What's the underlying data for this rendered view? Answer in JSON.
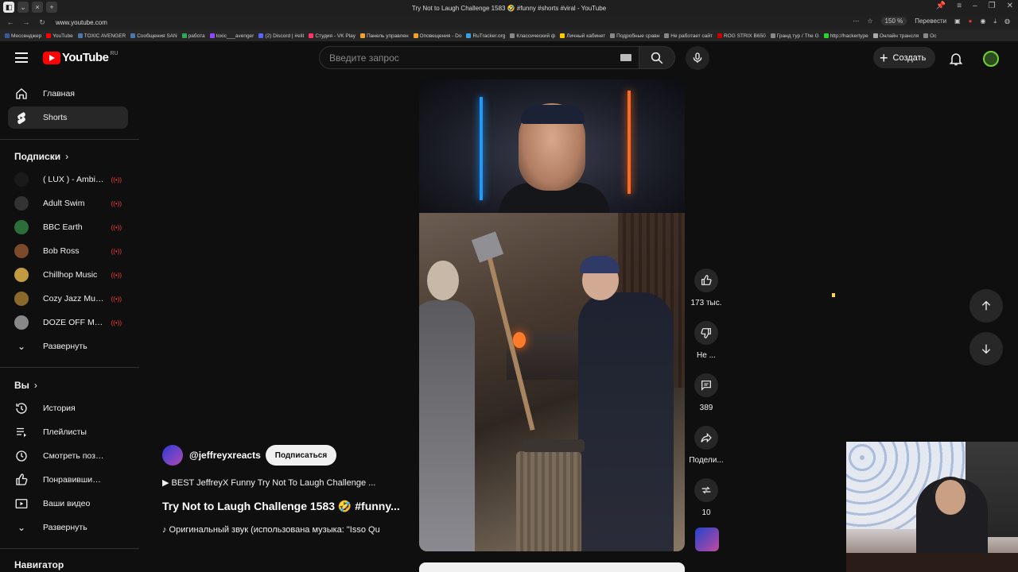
{
  "browser": {
    "url": "www.youtube.com",
    "tab_title": "Try Not to Laugh Challenge 1583 🤣 #funny #shorts #viral - YouTube",
    "zoom": "150 %",
    "translate_label": "Перевести",
    "bookmarks": [
      {
        "label": "Мессенджер",
        "color": "#3b5998"
      },
      {
        "label": "YouTube",
        "color": "#ff0000"
      },
      {
        "label": "TOXIC AVENGER",
        "color": "#4a76a8"
      },
      {
        "label": "Сообщения SAN",
        "color": "#4a76a8"
      },
      {
        "label": "работа",
        "color": "#2fa84f"
      },
      {
        "label": "toxic___avenger",
        "color": "#9146ff"
      },
      {
        "label": "(2) Discord | #elit",
        "color": "#5865f2"
      },
      {
        "label": "Студия - VK Play",
        "color": "#ff3366"
      },
      {
        "label": "Панель управлен",
        "color": "#f0a030"
      },
      {
        "label": "Оповещения - Do",
        "color": "#f0a030"
      },
      {
        "label": "RuTracker.org",
        "color": "#3aa0e0"
      },
      {
        "label": "Классический ф",
        "color": "#888888"
      },
      {
        "label": "Личный кабинет",
        "color": "#ffcc00"
      },
      {
        "label": "Подробные сравн",
        "color": "#888888"
      },
      {
        "label": "Не работает сайт",
        "color": "#888888"
      },
      {
        "label": "ROG STRIX B650",
        "color": "#cc0000"
      },
      {
        "label": "Гранд тур / The G",
        "color": "#888888"
      },
      {
        "label": "http://hackertype",
        "color": "#2bd42b"
      },
      {
        "label": "Онлайн трансля",
        "color": "#aaaaaa"
      },
      {
        "label": "Ос",
        "color": "#888888"
      }
    ]
  },
  "header": {
    "logo_text": "YouTube",
    "logo_region": "RU",
    "search_placeholder": "Введите запрос",
    "create_label": "Создать"
  },
  "sidebar": {
    "main_items": [
      {
        "label": "Главная",
        "icon": "home-icon"
      },
      {
        "label": "Shorts",
        "icon": "shorts-icon",
        "active": true
      }
    ],
    "subscriptions_title": "Подписки",
    "subscriptions": [
      {
        "label": "( LUX ) - Ambient...",
        "color": "#1a1a1a"
      },
      {
        "label": "Adult Swim",
        "color": "#333333"
      },
      {
        "label": "BBC Earth",
        "color": "#2b6e3a"
      },
      {
        "label": "Bob Ross",
        "color": "#7a4a2a"
      },
      {
        "label": "Chillhop Music",
        "color": "#c29b3e"
      },
      {
        "label": "Cozy Jazz Music",
        "color": "#8a6a2a"
      },
      {
        "label": "DOZE OFF MEDU...",
        "color": "#888888"
      }
    ],
    "expand_label_1": "Развернуть",
    "you_title": "Вы",
    "you_items": [
      {
        "label": "История",
        "icon": "history-icon"
      },
      {
        "label": "Плейлисты",
        "icon": "playlists-icon"
      },
      {
        "label": "Смотреть позже",
        "icon": "watch-later-icon"
      },
      {
        "label": "Понравившиеся",
        "icon": "liked-icon"
      },
      {
        "label": "Ваши видео",
        "icon": "your-videos-icon"
      }
    ],
    "expand_label_2": "Развернуть",
    "navigator_title": "Навигатор"
  },
  "short": {
    "channel": "@jeffreyxreacts",
    "subscribe_label": "Подписаться",
    "playlist": "▶ BEST JeffreyX Funny Try Not To Laugh Challenge ...",
    "title": "Try Not to Laugh Challenge 1583 🤣 #funny...",
    "audio": "♪ Оригинальный звук (использована музыка: \"Isso Qu"
  },
  "actions": {
    "likes": "173 тыс.",
    "dislike": "Не ...",
    "comments": "389",
    "share": "Подели...",
    "remix": "10"
  }
}
